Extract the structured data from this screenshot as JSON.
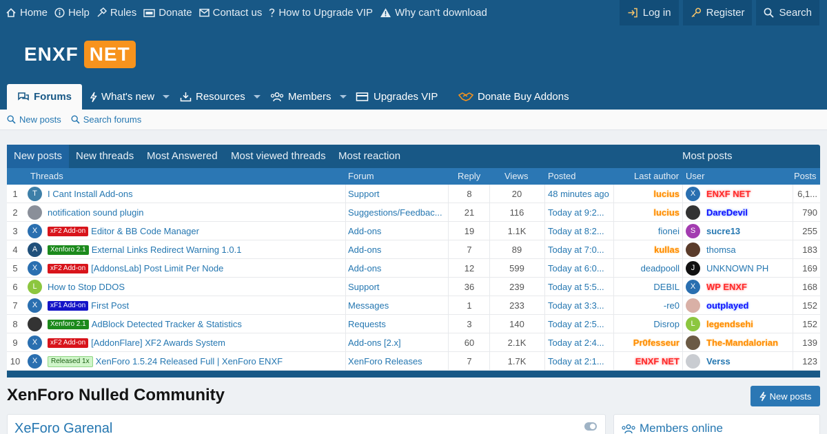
{
  "topbar": {
    "left": [
      "Home",
      "Help",
      "Rules",
      "Donate",
      "Contact us",
      "How to Upgrade VIP",
      "Why can't download"
    ],
    "right": [
      "Log in",
      "Register",
      "Search"
    ]
  },
  "logo": {
    "part1": "ENXF",
    "part2": "NET"
  },
  "nav": [
    "Forums",
    "What's new",
    "Resources",
    "Members",
    "Upgrades VIP",
    "Donate Buy Addons"
  ],
  "subnav": [
    "New posts",
    "Search forums"
  ],
  "widget": {
    "tabs": [
      "New posts",
      "New threads",
      "Most Answered",
      "Most viewed threads",
      "Most reaction",
      "Most posts"
    ],
    "columns": [
      "Threads",
      "Forum",
      "Reply",
      "Views",
      "Posted",
      "Last author",
      "User",
      "Posts"
    ],
    "rows": [
      {
        "n": "1",
        "av": "T",
        "badge": "",
        "title": "I Cant Install Add-ons",
        "forum": "Support",
        "reply": "8",
        "views": "20",
        "posted": "48 minutes ago",
        "last": "lucius",
        "user": "ENXF NET",
        "posts": "6,1..."
      },
      {
        "n": "2",
        "av": "",
        "badge": "",
        "title": "notification sound plugin",
        "forum": "Suggestions/Feedbac...",
        "reply": "21",
        "views": "116",
        "posted": "Today at 9:2...",
        "last": "lucius",
        "user": "DareDevil",
        "posts": "790"
      },
      {
        "n": "3",
        "av": "X",
        "badge": "xF2 Add-on",
        "title": "Editor & BB Code Manager",
        "forum": "Add-ons",
        "reply": "19",
        "views": "1.1K",
        "posted": "Today at 8:2...",
        "last": "fionei",
        "user": "sucre13",
        "posts": "255"
      },
      {
        "n": "4",
        "av": "A",
        "badge": "Xenforo 2.1",
        "title": "External Links Redirect Warning 1.0.1",
        "forum": "Add-ons",
        "reply": "7",
        "views": "89",
        "posted": "Today at 7:0...",
        "last": "kullas",
        "user": "thomsa",
        "posts": "183"
      },
      {
        "n": "5",
        "av": "X",
        "badge": "xF2 Add-on",
        "title": "[AddonsLab] Post Limit Per Node",
        "forum": "Add-ons",
        "reply": "12",
        "views": "599",
        "posted": "Today at 6:0...",
        "last": "deadpooll",
        "user": "UNKNOWN PH",
        "posts": "169"
      },
      {
        "n": "6",
        "av": "L",
        "badge": "",
        "title": "How to Stop DDOS",
        "forum": "Support",
        "reply": "36",
        "views": "239",
        "posted": "Today at 5:5...",
        "last": "DEBIL",
        "user": "WP ENXF",
        "posts": "168"
      },
      {
        "n": "7",
        "av": "X",
        "badge": "xF1 Add-on",
        "title": "First Post",
        "forum": "Messages",
        "reply": "1",
        "views": "233",
        "posted": "Today at 3:3...",
        "last": "-re0",
        "user": "outplayed",
        "posts": "152"
      },
      {
        "n": "8",
        "av": "",
        "badge": "Xenforo 2.1",
        "title": "AdBlock Detected Tracker & Statistics",
        "forum": "Requests",
        "reply": "3",
        "views": "140",
        "posted": "Today at 2:5...",
        "last": "Disrop",
        "user": "legendsehi",
        "posts": "152"
      },
      {
        "n": "9",
        "av": "X",
        "badge": "xF2 Add-on",
        "title": "[AddonFlare] XF2 Awards System",
        "forum": "Add-ons [2.x]",
        "reply": "60",
        "views": "2.1K",
        "posted": "Today at 2:4...",
        "last": "Pr0fesseur",
        "user": "The-Mandalorian",
        "posts": "139"
      },
      {
        "n": "10",
        "av": "X",
        "badge": "Released 1x",
        "title": "XenForo 1.5.24 Released Full | XenForo ENXF",
        "forum": "XenForo Releases",
        "reply": "7",
        "views": "1.7K",
        "posted": "Today at 2:1...",
        "last": "ENXF NET",
        "user": "Verss",
        "posts": "123"
      }
    ]
  },
  "main": {
    "title": "XenForo Nulled Community",
    "new_posts_btn": "New posts",
    "block_title": "XeForo Garenal",
    "members_online": "Members online"
  },
  "colors": {
    "header": "#185886",
    "link": "#2577b1",
    "accent": "#f7931d"
  }
}
